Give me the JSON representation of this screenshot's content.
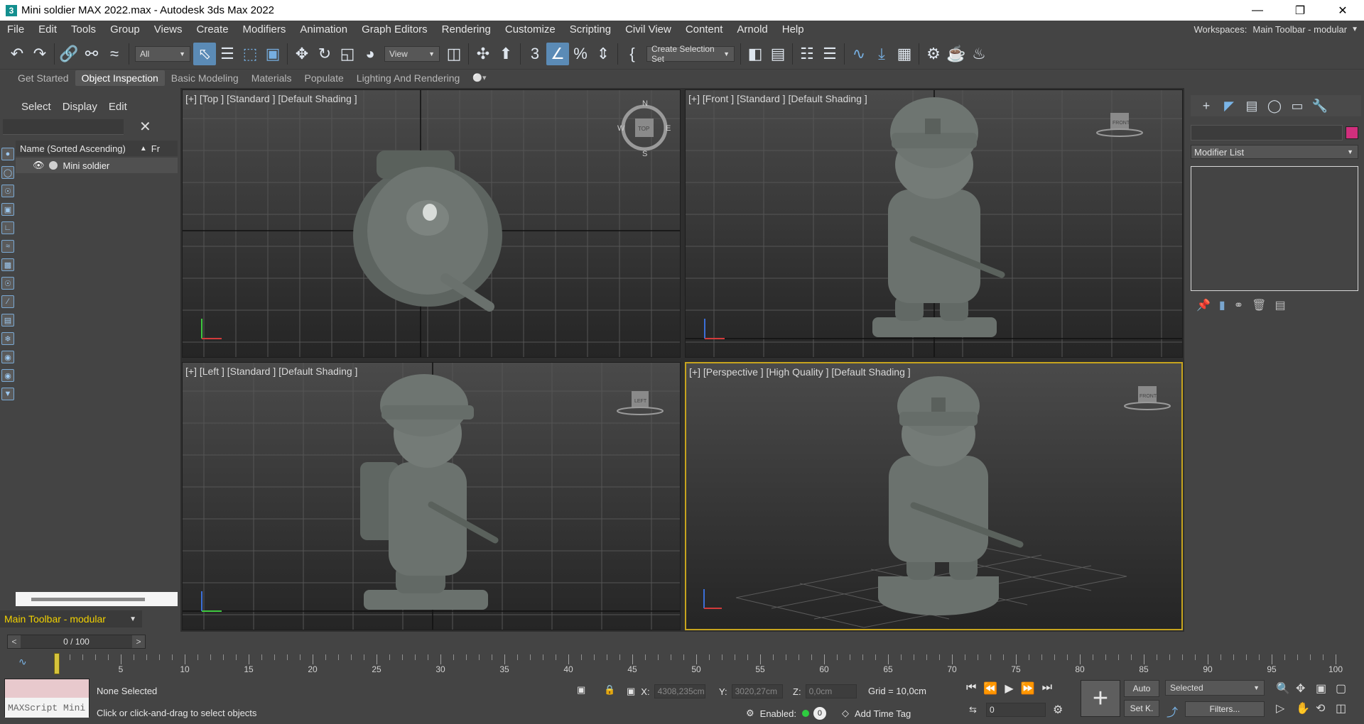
{
  "window": {
    "title": "Mini soldier MAX 2022.max - Autodesk 3ds Max 2022",
    "app_icon": "3"
  },
  "menu": [
    "File",
    "Edit",
    "Tools",
    "Group",
    "Views",
    "Create",
    "Modifiers",
    "Animation",
    "Graph Editors",
    "Rendering",
    "Customize",
    "Scripting",
    "Civil View",
    "Content",
    "Arnold",
    "Help"
  ],
  "workspaces": {
    "label": "Workspaces:",
    "value": "Main Toolbar - modular"
  },
  "toolbar": {
    "filter_value": "All",
    "ref_coord": "View",
    "selection_set": "Create Selection Set",
    "snap_value": "3"
  },
  "ribbon": [
    "Get Started",
    "Object Inspection",
    "Basic Modeling",
    "Materials",
    "Populate",
    "Lighting And Rendering"
  ],
  "ribbon_active": "Object Inspection",
  "scene_explorer": {
    "tabs": [
      "Select",
      "Display",
      "Edit"
    ],
    "column_header": "Name (Sorted Ascending)",
    "column_header2": "Fr",
    "sort_arrow": "▲",
    "items": [
      "Mini soldier"
    ]
  },
  "workspace_selector": "Main Toolbar - modular",
  "viewports": {
    "top": "[+] [Top ] [Standard ] [Default Shading ]",
    "front": "[+] [Front ] [Standard ] [Default Shading ]",
    "left": "[+] [Left ] [Standard ] [Default Shading ]",
    "perspective": "[+] [Perspective ] [High Quality ] [Default Shading ]",
    "compass": {
      "n": "N",
      "s": "S",
      "w": "W",
      "e": "E",
      "cube": "TOP"
    },
    "cube_front": "FRONT",
    "cube_left": "LEFT"
  },
  "command_panel": {
    "modifier_list": "Modifier List",
    "object_color": "#d12f7d"
  },
  "timeline": {
    "slider_value": "0 / 100",
    "slider_prev": "<",
    "slider_next": ">",
    "tick_labels": [
      "0",
      "5",
      "10",
      "15",
      "20",
      "25",
      "30",
      "35",
      "40",
      "45",
      "50",
      "55",
      "60",
      "65",
      "70",
      "75",
      "80",
      "85",
      "90",
      "95",
      "100"
    ]
  },
  "status": {
    "maxscript_label": "MAXScript Mini",
    "selection": "None Selected",
    "prompt": "Click or click-and-drag to select objects",
    "x_label": "X:",
    "x_value": "4308,235cm",
    "y_label": "Y:",
    "y_value": "3020,27cm",
    "z_label": "Z:",
    "z_value": "0,0cm",
    "grid": "Grid = 10,0cm",
    "enabled_label": "Enabled:",
    "enabled_value": "0",
    "add_time_tag": "Add Time Tag",
    "frame_value": "0",
    "auto_label": "Auto",
    "setk_label": "Set K.",
    "key_filter": "Selected",
    "filters_label": "Filters..."
  }
}
